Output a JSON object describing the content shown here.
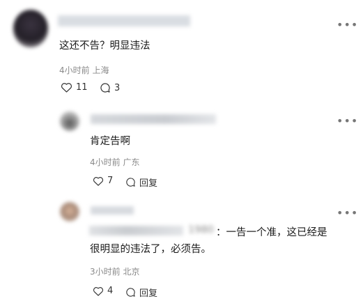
{
  "comment_main": {
    "text": "这还不告？明显违法",
    "meta": "4小时前 上海",
    "likes": "11",
    "replies": "3"
  },
  "reply_1": {
    "text": "肯定告啊",
    "meta": "4小时前 广东",
    "likes": "7",
    "reply_label": "回复"
  },
  "reply_2": {
    "reply_prefix": "1980",
    "text_line1": "：一告一个准，这已经是",
    "text_line2": "很明显的违法了，必须告。",
    "meta": "3小时前 北京",
    "likes": "4",
    "reply_label": "回复"
  },
  "icons": {
    "more": "more-dots-icon",
    "like": "heart-outline-icon",
    "comment": "comment-bubble-icon"
  }
}
